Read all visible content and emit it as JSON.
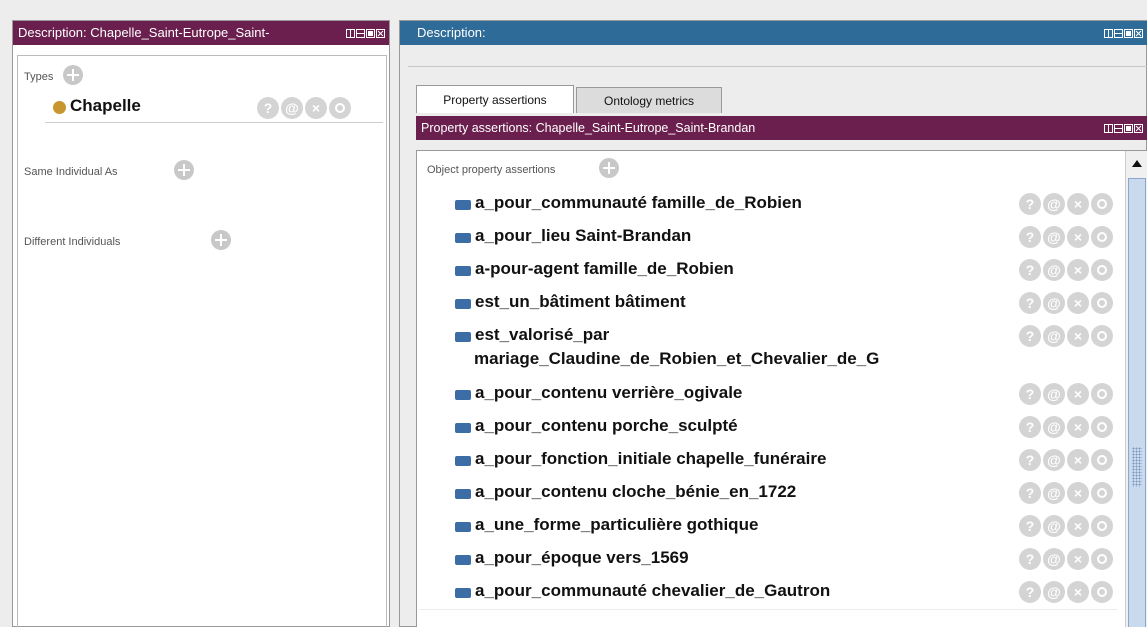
{
  "left_panel": {
    "header_title": "Description: Chapelle_Saint-Eutrope_Saint-",
    "types_label": "Types",
    "type_value": "Chapelle",
    "same_individual_label": "Same Individual As",
    "different_individuals_label": "Different Individuals"
  },
  "right_panel": {
    "header_title": "Description:",
    "tabs": [
      {
        "label": "Property assertions",
        "active": true
      },
      {
        "label": "Ontology metrics",
        "active": false
      }
    ],
    "sub_header_title": "Property assertions: Chapelle_Saint-Eutrope_Saint-Brandan",
    "object_property_label": "Object property assertions",
    "assertions": [
      {
        "text": "a_pour_communauté  famille_de_Robien"
      },
      {
        "text": "a_pour_lieu  Saint-Brandan"
      },
      {
        "text": "a-pour-agent  famille_de_Robien"
      },
      {
        "text": "est_un_bâtiment  bâtiment"
      },
      {
        "text": "est_valorisé_par",
        "text2": "mariage_Claudine_de_Robien_et_Chevalier_de_G"
      },
      {
        "text": "a_pour_contenu  verrière_ogivale"
      },
      {
        "text": "a_pour_contenu  porche_sculpté"
      },
      {
        "text": "a_pour_fonction_initiale  chapelle_funéraire"
      },
      {
        "text": "a_pour_contenu  cloche_bénie_en_1722"
      },
      {
        "text": "a_une_forme_particulière  gothique"
      },
      {
        "text": "a_pour_époque  vers_1569"
      },
      {
        "text": "a_pour_communauté  chevalier_de_Gautron"
      }
    ]
  },
  "button_glyphs": {
    "help": "?",
    "annotate": "@",
    "delete": "×"
  },
  "colors": {
    "left_header": "#6b1f4e",
    "right_header": "#2f6b98",
    "sub_header": "#6b1f4e",
    "type_dot": "#c8962e",
    "property_icon": "#3c6ea5"
  }
}
